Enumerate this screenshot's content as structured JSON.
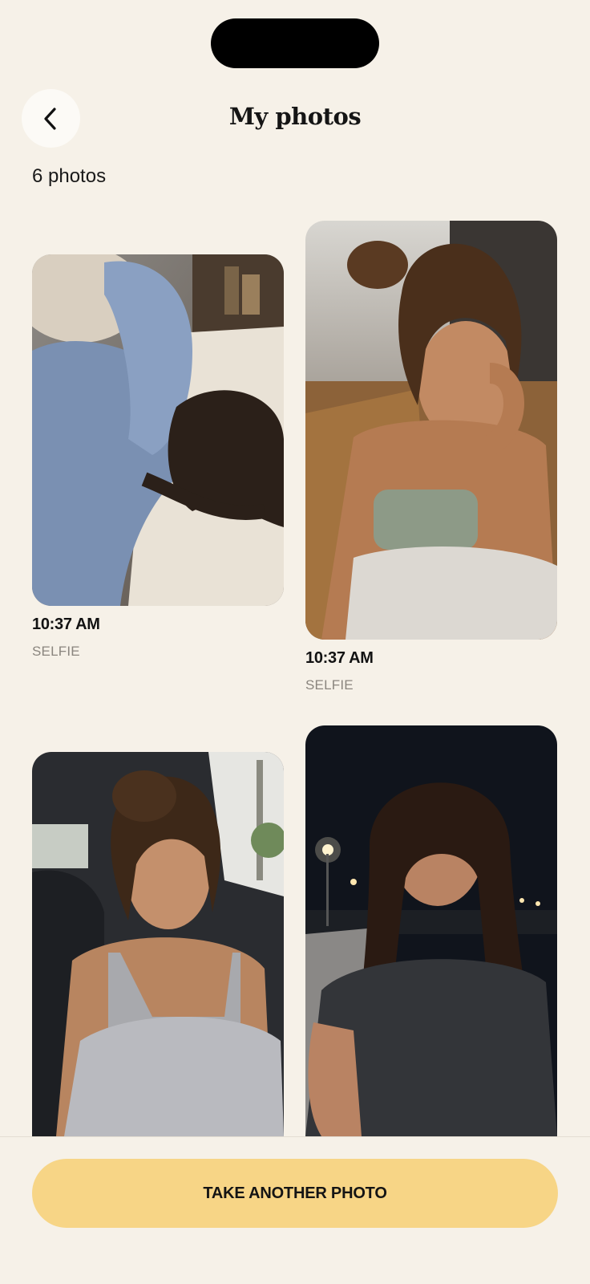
{
  "header": {
    "title": "My photos",
    "back_icon": "chevron-left-icon"
  },
  "summary": {
    "count_label": "6 photos"
  },
  "photos": [
    {
      "time": "10:37 AM",
      "kind": "SELFIE",
      "scene": "lying in bed in blue knit sweater"
    },
    {
      "time": "10:37 AM",
      "kind": "SELFIE",
      "scene": "sitting on wooden floor, hair in bun"
    },
    {
      "time": "",
      "kind": "",
      "scene": "car interior selfie in grey outfit"
    },
    {
      "time": "",
      "kind": "",
      "scene": "night waterfront selfie in black tee"
    }
  ],
  "footer": {
    "cta_label": "TAKE ANOTHER PHOTO"
  },
  "colors": {
    "background": "#f6f1e8",
    "accent": "#f7d586",
    "text": "#111111",
    "muted": "#8a857e"
  }
}
